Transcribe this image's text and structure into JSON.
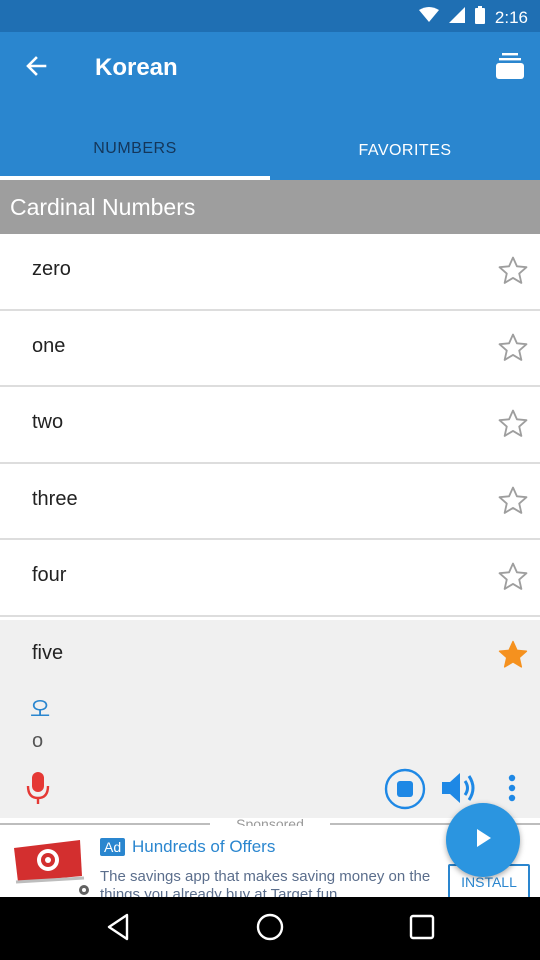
{
  "status_bar": {
    "time": "2:16",
    "bg_color": "#1f6fb3"
  },
  "app_bar": {
    "title": "Korean",
    "back_icon": "arrow-left-icon",
    "menu_icon": "stack-icon",
    "color": "#2a86cf"
  },
  "tabs": [
    {
      "label": "NUMBERS",
      "active": true
    },
    {
      "label": "FAVORITES",
      "active": false
    }
  ],
  "section": {
    "title": "Cardinal Numbers"
  },
  "list": {
    "items": [
      {
        "label": "zero",
        "favorite": false
      },
      {
        "label": "one",
        "favorite": false
      },
      {
        "label": "two",
        "favorite": false
      },
      {
        "label": "three",
        "favorite": false
      },
      {
        "label": "four",
        "favorite": false
      }
    ]
  },
  "expanded_item": {
    "label": "five",
    "favorite": true,
    "korean": "오",
    "romanization": "o",
    "star_color": "#f5911e"
  },
  "ad": {
    "sponsored_label": "Sponsored",
    "badge": "Ad",
    "title": "Hundreds of Offers",
    "description": "The savings app that makes saving money on the things you already buy at Target fun",
    "install_label": "INSTALL"
  }
}
